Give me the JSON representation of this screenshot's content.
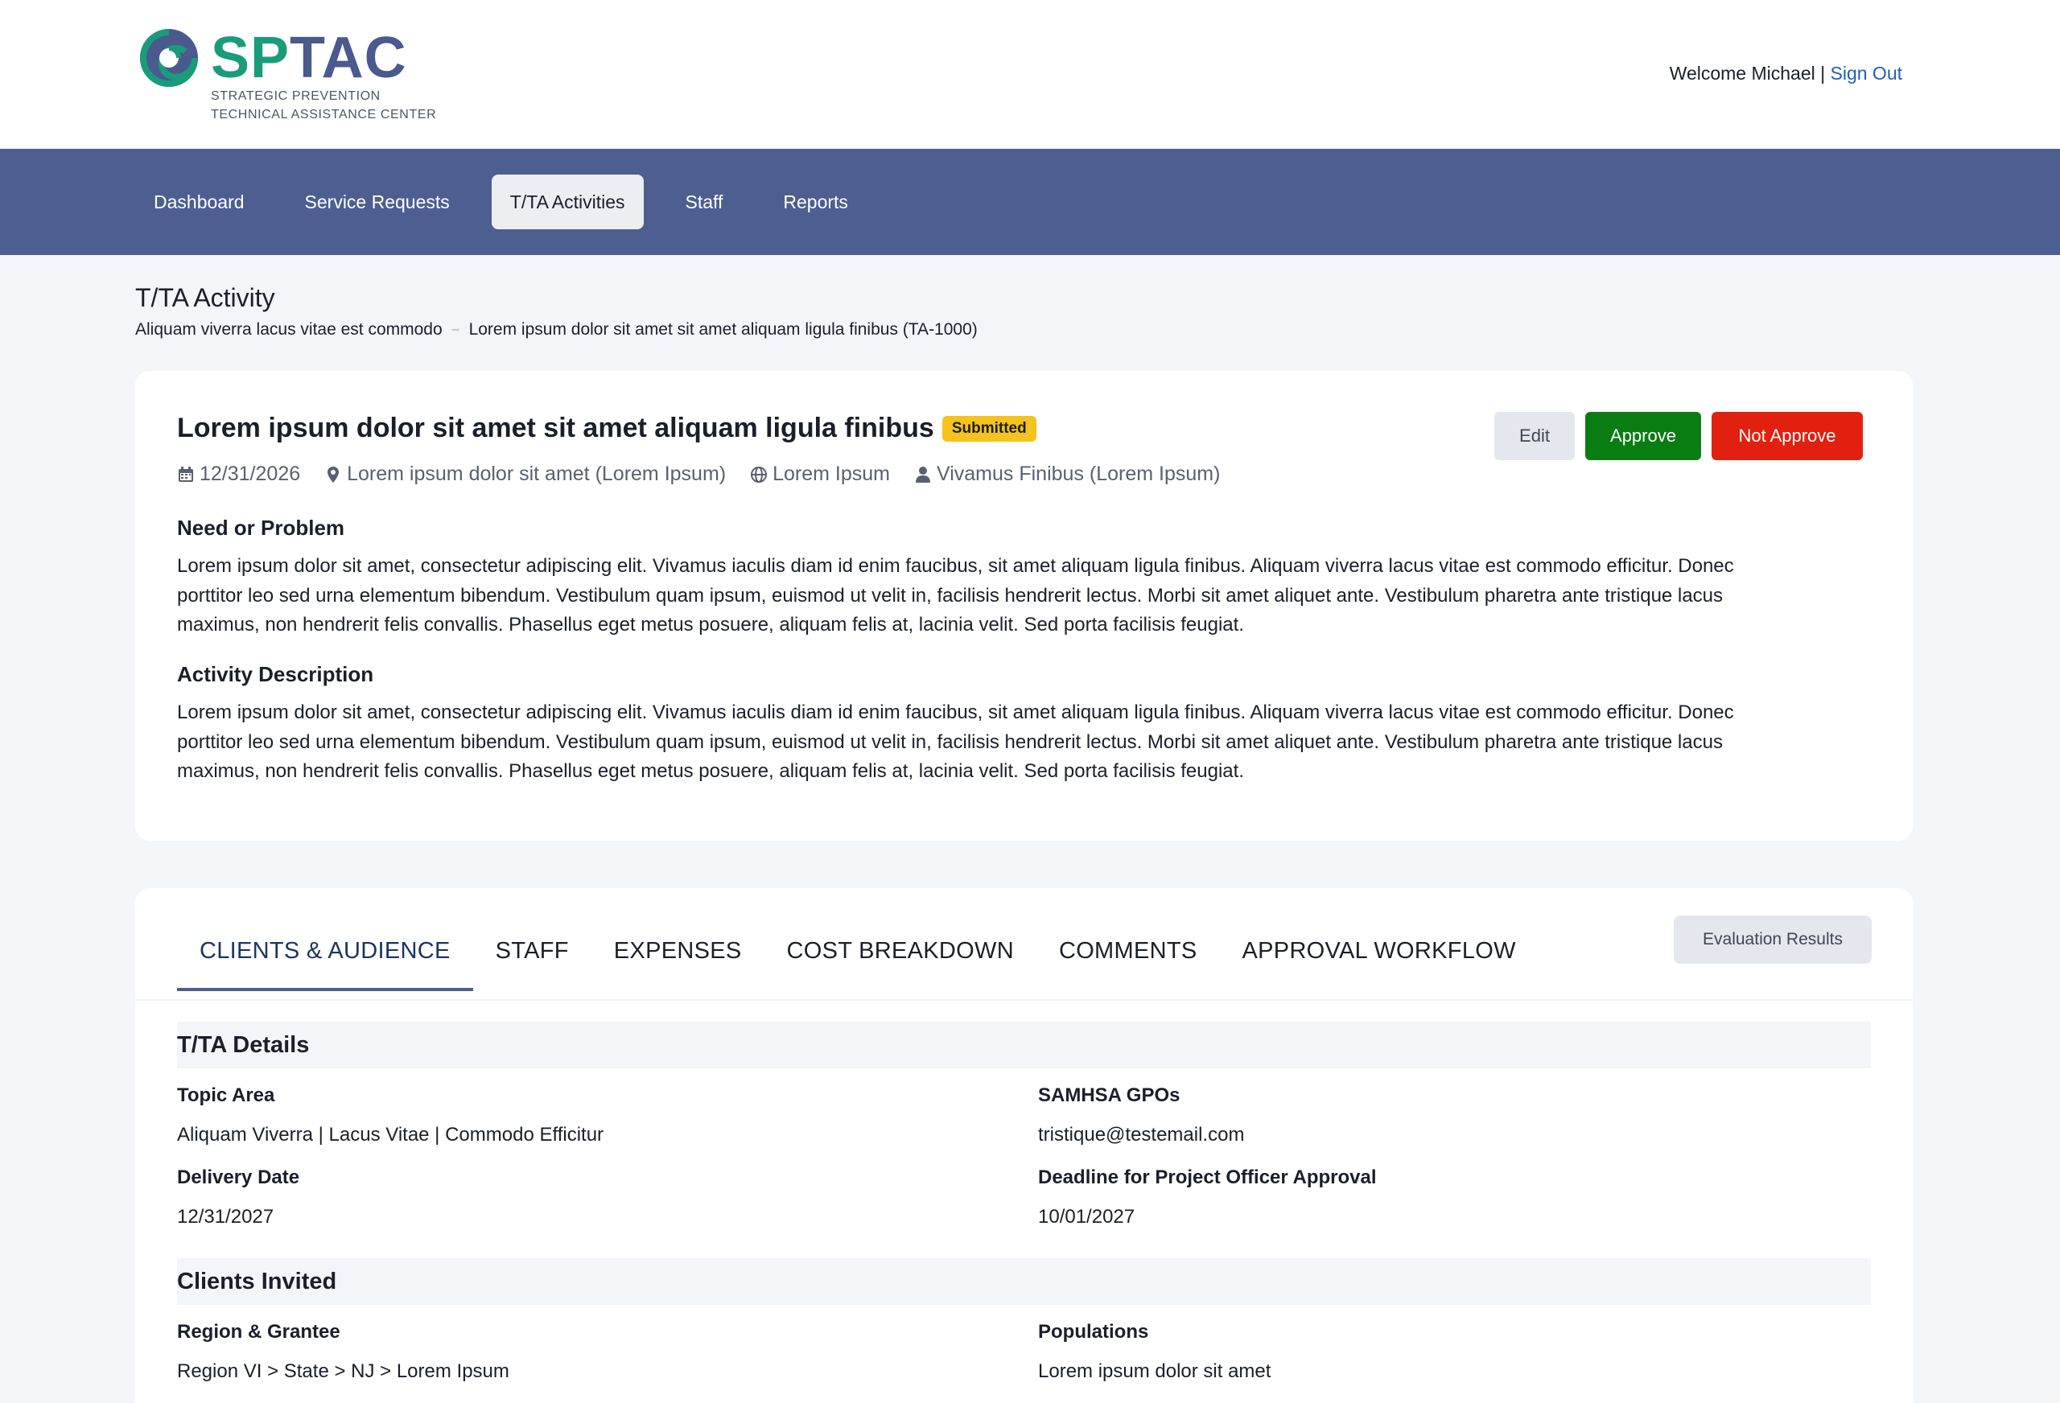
{
  "header": {
    "logo_word_1": "SP",
    "logo_word_2": "TAC",
    "logo_sub_1": "STRATEGIC PREVENTION",
    "logo_sub_2": "TECHNICAL ASSISTANCE CENTER",
    "welcome": "Welcome Michael | ",
    "signout": "Sign Out"
  },
  "nav": {
    "items": [
      "Dashboard",
      "Service Requests",
      "T/TA Activities",
      "Staff",
      "Reports"
    ],
    "active": "T/TA Activities"
  },
  "page": {
    "title": "T/TA Activity",
    "breadcrumb": [
      "Aliquam viverra lacus vitae est commodo",
      "Lorem ipsum dolor sit amet sit amet aliquam ligula finibus (TA-1000)"
    ]
  },
  "activity": {
    "title": "Lorem ipsum dolor sit amet sit amet aliquam ligula finibus",
    "status": "Submitted",
    "buttons": {
      "edit": "Edit",
      "approve": "Approve",
      "not_approve": "Not Approve"
    },
    "meta": {
      "date": "12/31/2026",
      "location": "Lorem ipsum dolor sit amet (Lorem Ipsum)",
      "language": "Lorem Ipsum",
      "person": "Vivamus Finibus (Lorem Ipsum)"
    },
    "need_heading": "Need or Problem",
    "need_lines": [
      "Lorem ipsum dolor sit amet, consectetur adipiscing elit. Vivamus iaculis diam id enim faucibus, sit amet aliquam ligula finibus. Aliquam viverra lacus vitae est commodo efficitur. Donec",
      "porttitor leo sed urna elementum bibendum. Vestibulum quam ipsum, euismod ut velit in, facilisis hendrerit lectus. Morbi sit amet aliquet ante. Vestibulum pharetra ante tristique lacus",
      "maximus, non hendrerit felis convallis. Phasellus eget metus posuere, aliquam felis at, lacinia velit. Sed porta facilisis feugiat."
    ],
    "desc_heading": "Activity Description",
    "desc_lines": [
      "Lorem ipsum dolor sit amet, consectetur adipiscing elit. Vivamus iaculis diam id enim faucibus, sit amet aliquam ligula finibus. Aliquam viverra lacus vitae est commodo efficitur. Donec",
      "porttitor leo sed urna elementum bibendum. Vestibulum quam ipsum, euismod ut velit in, facilisis hendrerit lectus. Morbi sit amet aliquet ante. Vestibulum pharetra ante tristique lacus",
      "maximus, non hendrerit felis convallis. Phasellus eget metus posuere, aliquam felis at, lacinia velit. Sed porta facilisis feugiat."
    ]
  },
  "tabs": {
    "items": [
      "CLIENTS & AUDIENCE",
      "STAFF",
      "EXPENSES",
      "COST BREAKDOWN",
      "COMMENTS",
      "APPROVAL WORKFLOW"
    ],
    "active": "CLIENTS & AUDIENCE",
    "eval_button": "Evaluation Results"
  },
  "details": {
    "heading": "T/TA Details",
    "topic_label": "Topic Area",
    "topic_value": "Aliquam Viverra | Lacus Vitae | Commodo Efficitur",
    "gpo_label": "SAMHSA GPOs",
    "gpo_value": "tristique@testemail.com",
    "delivery_label": "Delivery Date",
    "delivery_value": "12/31/2027",
    "deadline_label": "Deadline for Project Officer Approval",
    "deadline_value": "10/01/2027"
  },
  "clients": {
    "heading": "Clients Invited",
    "region_label": "Region & Grantee",
    "region_value": "Region VI > State > NJ > Lorem Ipsum",
    "pop_label": "Populations",
    "pop_value": "Lorem ipsum dolor sit amet"
  },
  "colors": {
    "nav_bg": "#4d5f90",
    "approve": "#0a7d12",
    "not_approve": "#e1200f",
    "badge": "#f6c21c",
    "link": "#1e5fb8"
  }
}
